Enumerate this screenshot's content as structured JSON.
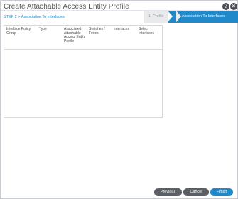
{
  "dialog": {
    "title": "Create Attachable Access Entity Profile",
    "help_icon": "question-icon",
    "close_icon": "close-icon"
  },
  "wizard": {
    "steps": [
      {
        "label": "1. Profile",
        "active": false
      },
      {
        "label": "2. Association To Interfaces",
        "active": true
      }
    ]
  },
  "step_heading": "STEP 2 > Association To Interfaces",
  "table": {
    "columns": [
      "Interface Policy Group",
      "Type",
      "Associated Attachable Access Entity Profile",
      "Switches / Fexes",
      "Interfaces",
      "Select Interfaces"
    ],
    "rows": []
  },
  "footer": {
    "previous_label": "Previous",
    "cancel_label": "Cancel",
    "finish_label": "Finish"
  },
  "colors": {
    "accent": "#1f89c9",
    "secondary_button": "#5b5f66",
    "inactive_step": "#e9eaec"
  }
}
